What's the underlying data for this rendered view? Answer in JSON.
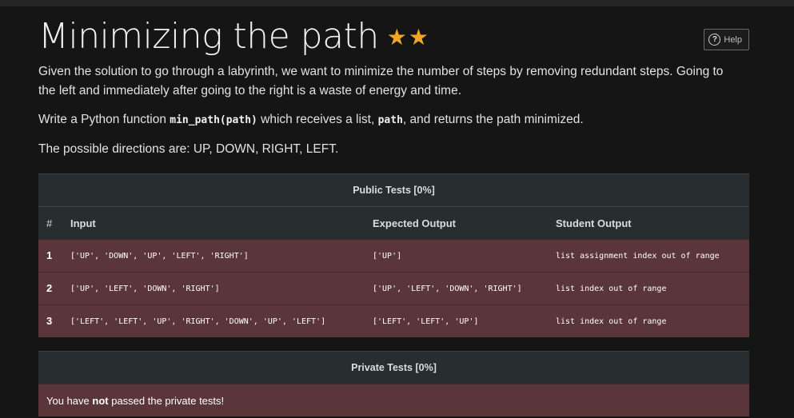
{
  "title": "Minimizing the path",
  "stars": "★★",
  "help_label": "Help",
  "help_icon": "question-circle",
  "description": {
    "p1": "Given the solution to go through a labyrinth, we want to minimize the number of steps by removing redundant steps. Going to the left and immediately after going to the right is a waste of energy and time.",
    "p2_before": "Write a Python function ",
    "p2_code1": "min_path(path)",
    "p2_middle": " which receives a list, ",
    "p2_code2": "path",
    "p2_after": ", and returns the path minimized.",
    "p3": "The possible directions are: UP, DOWN, RIGHT, LEFT."
  },
  "public_tests": {
    "title": "Public Tests [0%]",
    "columns": {
      "hash": "#",
      "input": "Input",
      "expected": "Expected Output",
      "student": "Student Output"
    },
    "rows": [
      {
        "num": "1",
        "input": "['UP', 'DOWN', 'UP', 'LEFT', 'RIGHT']",
        "expected": "['UP']",
        "student": "list assignment index out of range"
      },
      {
        "num": "2",
        "input": "['UP', 'LEFT', 'DOWN', 'RIGHT']",
        "expected": "['UP', 'LEFT', 'DOWN', 'RIGHT']",
        "student": "list index out of range"
      },
      {
        "num": "3",
        "input": "['LEFT', 'LEFT', 'UP', 'RIGHT', 'DOWN', 'UP', 'LEFT']",
        "expected": "['LEFT', 'LEFT', 'UP']",
        "student": "list index out of range"
      }
    ]
  },
  "private_tests": {
    "title": "Private Tests [0%]",
    "msg_before": "You have ",
    "msg_bold": "not",
    "msg_after": " passed the private tests!"
  },
  "colors": {
    "star": "#f2a623",
    "failed_row": "#5a3539",
    "header_bg": "#282d30"
  }
}
